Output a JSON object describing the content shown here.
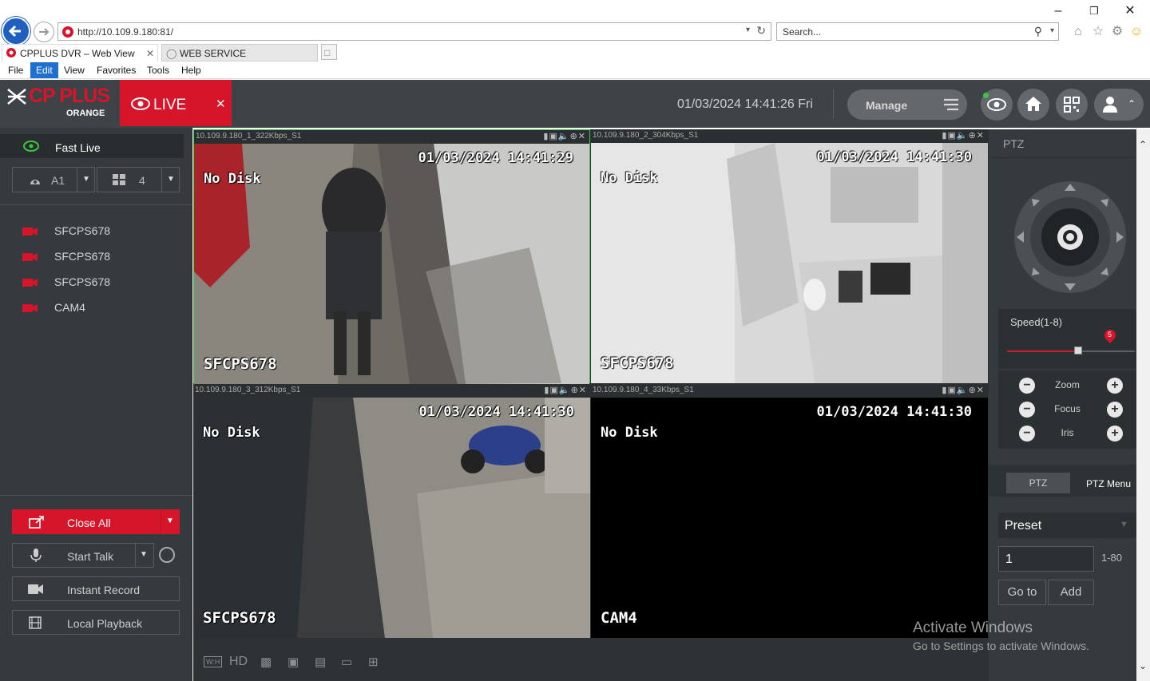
{
  "browser": {
    "url": "http://10.109.9.180:81/",
    "search_placeholder": "Search...",
    "tabs": [
      {
        "label": "CPPLUS DVR – Web View"
      },
      {
        "label": "WEB SERVICE"
      }
    ],
    "menu": [
      "File",
      "Edit",
      "View",
      "Favorites",
      "Tools",
      "Help"
    ]
  },
  "header": {
    "logo_text": "CP PLUS",
    "logo_sub": "ORANGE",
    "live_label": "LIVE",
    "datetime": "01/03/2024 14:41:26 Fri",
    "manage_label": "Manage"
  },
  "left": {
    "fast_live": "Fast Live",
    "channel_select": "A1",
    "layout_select": "4",
    "cameras": [
      "SFCPS678",
      "SFCPS678",
      "SFCPS678",
      "CAM4"
    ],
    "actions": {
      "close_all": "Close All",
      "start_talk": "Start Talk",
      "instant_record": "Instant Record",
      "local_playback": "Local Playback"
    }
  },
  "cells": [
    {
      "title": "10.109.9.180_1_322Kbps_S1",
      "time": "01/03/2024 14:41:29",
      "disk": "No Disk",
      "name": "SFCPS678"
    },
    {
      "title": "10.109.9.180_2_304Kbps_S1",
      "time": "01/03/2024 14:41:30",
      "disk": "No Disk",
      "name": "SFCPS678"
    },
    {
      "title": "10.109.9.180_3_312Kbps_S1",
      "time": "01/03/2024 14:41:30",
      "disk": "No Disk",
      "name": "SFCPS678"
    },
    {
      "title": "10.109.9.180_4_33Kbps_S1",
      "time": "01/03/2024 14:41:30",
      "disk": "No Disk",
      "name": "CAM4"
    }
  ],
  "bottom_tools": {
    "ratio": "W:H",
    "hd": "HD"
  },
  "ptz": {
    "title": "PTZ",
    "speed_label": "Speed(1-8)",
    "speed_value": "5",
    "zoom": "Zoom",
    "focus": "Focus",
    "iris": "Iris",
    "tab_ptz": "PTZ",
    "tab_menu": "PTZ Menu",
    "preset_label": "Preset",
    "preset_value": "1",
    "preset_range": "1-80",
    "goto": "Go to",
    "add": "Add"
  },
  "watermark": {
    "line1": "Activate Windows",
    "line2": "Go to Settings to activate Windows."
  },
  "colors": {
    "accent": "#d6142a",
    "panel": "#343a3d",
    "header": "#3d4346",
    "selected_border": "#3ec43e"
  }
}
